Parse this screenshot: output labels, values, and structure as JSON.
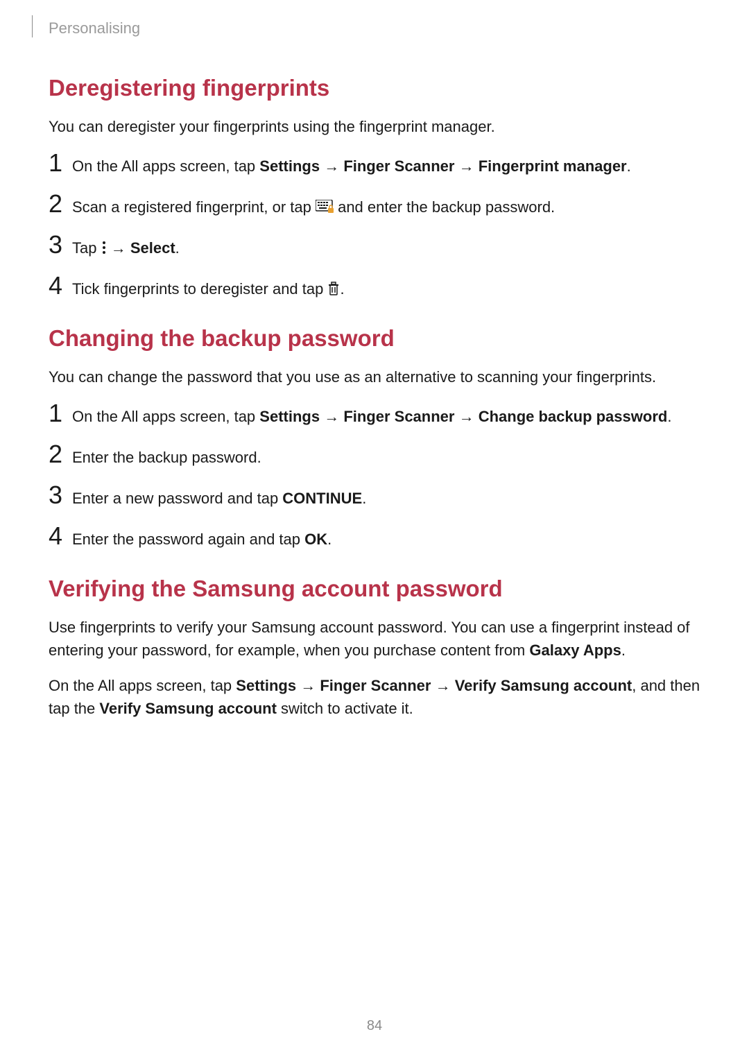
{
  "header": {
    "section": "Personalising"
  },
  "sections": [
    {
      "heading": "Deregistering fingerprints",
      "intro": "You can deregister your fingerprints using the fingerprint manager.",
      "steps": [
        {
          "num": "1",
          "pre": "On the All apps screen, tap ",
          "bold1": "Settings",
          "mid1": " → ",
          "bold2": "Finger Scanner",
          "mid2": " → ",
          "bold3": "Fingerprint manager",
          "post": "."
        },
        {
          "num": "2",
          "pre": "Scan a registered fingerprint, or tap ",
          "icon": "keyboard-lock-icon",
          "post": " and enter the backup password."
        },
        {
          "num": "3",
          "pre": "Tap ",
          "icon": "more-options-icon",
          "mid": " → ",
          "bold1": "Select",
          "post": "."
        },
        {
          "num": "4",
          "pre": "Tick fingerprints to deregister and tap ",
          "icon": "trash-icon",
          "post": "."
        }
      ]
    },
    {
      "heading": "Changing the backup password",
      "intro": "You can change the password that you use as an alternative to scanning your fingerprints.",
      "steps": [
        {
          "num": "1",
          "pre": "On the All apps screen, tap ",
          "bold1": "Settings",
          "mid1": " → ",
          "bold2": "Finger Scanner",
          "mid2": " → ",
          "bold3": "Change backup password",
          "post": "."
        },
        {
          "num": "2",
          "pre": "Enter the backup password."
        },
        {
          "num": "3",
          "pre": "Enter a new password and tap ",
          "bold1": "CONTINUE",
          "post": "."
        },
        {
          "num": "4",
          "pre": "Enter the password again and tap ",
          "bold1": "OK",
          "post": "."
        }
      ]
    },
    {
      "heading": "Verifying the Samsung account password",
      "paragraphs": [
        {
          "p1": "Use fingerprints to verify your Samsung account password. You can use a fingerprint instead of entering your password, for example, when you purchase content from ",
          "bold1": "Galaxy Apps",
          "p2": "."
        },
        {
          "p1": "On the All apps screen, tap ",
          "bold1": "Settings",
          "p2": " → ",
          "bold2": "Finger Scanner",
          "p3": " → ",
          "bold3": "Verify Samsung account",
          "p4": ", and then tap the ",
          "bold4": "Verify Samsung account",
          "p5": " switch to activate it."
        }
      ]
    }
  ],
  "pageNumber": "84"
}
